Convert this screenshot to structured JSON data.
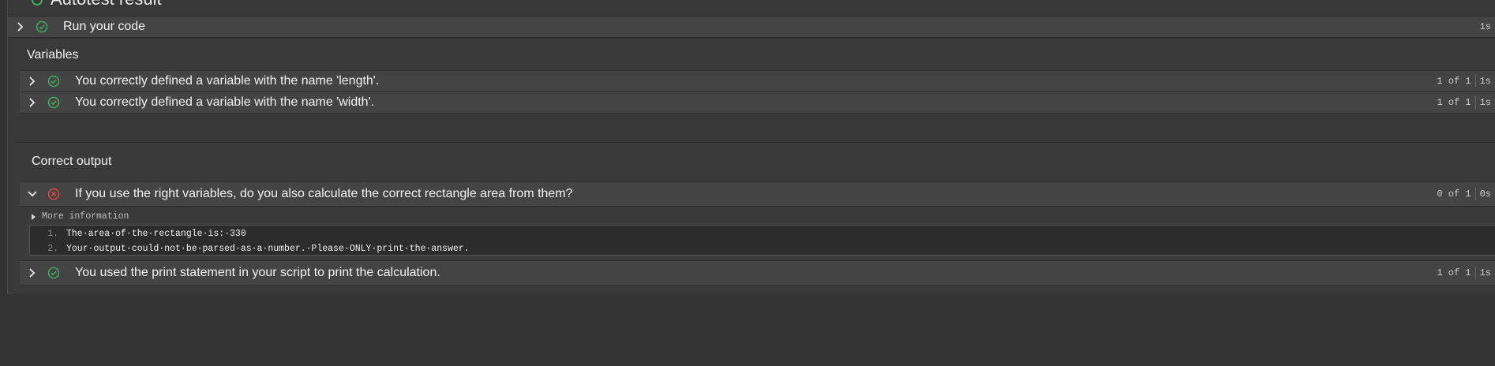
{
  "header": {
    "title": "Autotest result"
  },
  "run_code": {
    "label": "Run your code",
    "time": "1s"
  },
  "sections": {
    "variables": {
      "title": "Variables",
      "tests": [
        {
          "label": "You correctly defined a variable with the name 'length'.",
          "score": "1 of 1",
          "time": "1s",
          "status": "pass"
        },
        {
          "label": "You correctly defined a variable with the name 'width'.",
          "score": "1 of 1",
          "time": "1s",
          "status": "pass"
        }
      ]
    },
    "correct_output": {
      "title": "Correct output",
      "tests": [
        {
          "label": "If you use the right variables, do you also calculate the correct rectangle area from them?",
          "score": "0 of 1",
          "time": "0s",
          "status": "fail",
          "expanded": true
        },
        {
          "label": "You used the print statement in your script to print the calculation.",
          "score": "1 of 1",
          "time": "1s",
          "status": "pass"
        }
      ]
    }
  },
  "more_info": {
    "label": "More information"
  },
  "output": {
    "lines": [
      {
        "num": "1.",
        "text": "The·area·of·the·rectangle·is:·330"
      },
      {
        "num": "2.",
        "text": "Your·output·could·not·be·parsed·as·a·number.·Please·ONLY·print·the·answer."
      }
    ]
  },
  "colors": {
    "pass": "#3fae5f",
    "fail": "#e04848",
    "background": "#333333"
  }
}
